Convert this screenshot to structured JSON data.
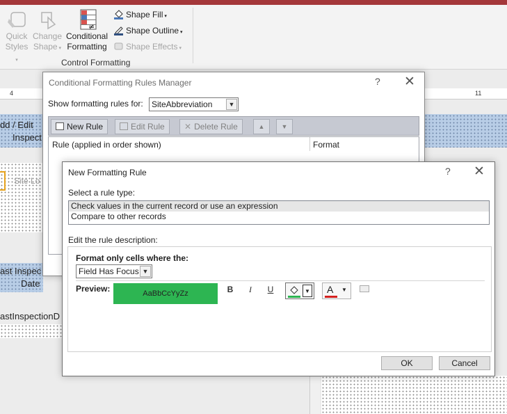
{
  "ribbon": {
    "quick_styles": [
      "Quick",
      "Styles"
    ],
    "change_shape": [
      "Change",
      "Shape"
    ],
    "conditional_formatting": [
      "Conditional",
      "Formatting"
    ],
    "shape_fill": "Shape Fill",
    "shape_outline": "Shape Outline",
    "shape_effects": "Shape Effects",
    "group_label": "Control Formatting"
  },
  "background": {
    "ruler_numbers": [
      "4",
      "11"
    ],
    "form_header_line1": "dd / Edit",
    "form_header_line2": "Inspect",
    "site_field": "Site Lo",
    "last_inspect_line1": "ast Inspec",
    "last_inspect_line2": "Date",
    "last_inspection_field": "astInspectionD"
  },
  "rules_manager": {
    "title": "Conditional Formatting Rules Manager",
    "help": "?",
    "close": "✕",
    "show_rules_for_label": "Show formatting rules for:",
    "show_rules_for_value": "SiteAbbreviation",
    "new_rule": "New Rule",
    "edit_rule": "Edit Rule",
    "delete_rule": "Delete Rule",
    "col_rule": "Rule (applied in order shown)",
    "col_format": "Format"
  },
  "new_rule": {
    "title": "New Formatting Rule",
    "help": "?",
    "close": "✕",
    "select_rule_type_label": "Select a rule type:",
    "rule_types": [
      "Check values in the current record or use an expression",
      "Compare to other records"
    ],
    "edit_description_label": "Edit the rule description:",
    "format_only_label": "Format only cells where the:",
    "condition_value": "Field Has Focus",
    "preview_label": "Preview:",
    "preview_text": "AaBbCcYyZz",
    "preview_bg_color": "#2db552",
    "bold": "B",
    "italic": "I",
    "underline": "U",
    "font_color_letter": "A",
    "ok": "OK",
    "cancel": "Cancel"
  },
  "colors": {
    "fill_underline": "#2db552",
    "font_underline": "#d4201f",
    "title_bar": "#a4373a"
  }
}
